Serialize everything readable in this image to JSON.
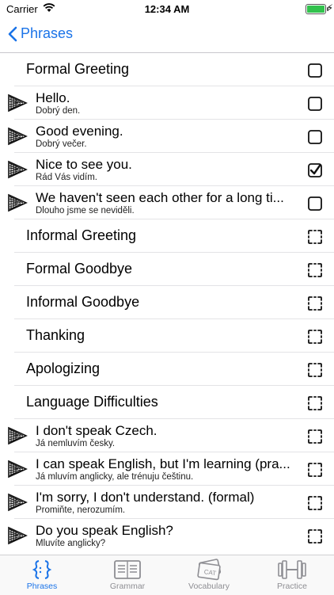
{
  "status_bar": {
    "carrier": "Carrier",
    "time": "12:34 AM"
  },
  "nav": {
    "back_label": "Phrases"
  },
  "rows": [
    {
      "kind": "category",
      "label": "Formal Greeting",
      "state": "empty"
    },
    {
      "kind": "phrase",
      "text": "Hello.",
      "translation": "Dobrý den.",
      "state": "empty"
    },
    {
      "kind": "phrase",
      "text": "Good evening.",
      "translation": "Dobrý večer.",
      "state": "empty"
    },
    {
      "kind": "phrase",
      "text": "Nice to see you.",
      "translation": "Rád Vás vidím.",
      "state": "checked"
    },
    {
      "kind": "phrase",
      "text": "We haven't seen each other for a long ti...",
      "translation": "Dlouho jsme se neviděli.",
      "state": "empty"
    },
    {
      "kind": "category",
      "label": "Informal Greeting",
      "state": "dashed"
    },
    {
      "kind": "category",
      "label": "Formal Goodbye",
      "state": "dashed"
    },
    {
      "kind": "category",
      "label": "Informal Goodbye",
      "state": "dashed"
    },
    {
      "kind": "category",
      "label": "Thanking",
      "state": "dashed"
    },
    {
      "kind": "category",
      "label": "Apologizing",
      "state": "dashed"
    },
    {
      "kind": "category",
      "label": "Language Difficulties",
      "state": "dashed"
    },
    {
      "kind": "phrase",
      "text": "I don't speak Czech.",
      "translation": "Já nemluvím česky.",
      "state": "dashed"
    },
    {
      "kind": "phrase",
      "text": "I can speak English, but I'm learning (pra...",
      "translation": "Já mluvím anglicky, ale trénuju češtinu.",
      "state": "dashed"
    },
    {
      "kind": "phrase",
      "text": "I'm sorry, I don't understand. (formal)",
      "translation": "Promiňte, nerozumím.",
      "state": "dashed"
    },
    {
      "kind": "phrase",
      "text": "Do you speak English?",
      "translation": "Mluvíte anglicky?",
      "state": "dashed"
    }
  ],
  "tabs": [
    {
      "label": "Phrases",
      "icon": "phrases-icon",
      "active": true
    },
    {
      "label": "Grammar",
      "icon": "grammar-icon",
      "active": false
    },
    {
      "label": "Vocabulary",
      "icon": "vocabulary-icon",
      "active": false
    },
    {
      "label": "Practice",
      "icon": "practice-icon",
      "active": false
    }
  ],
  "colors": {
    "accent": "#1a73e8",
    "inactive": "#8e8e93"
  }
}
